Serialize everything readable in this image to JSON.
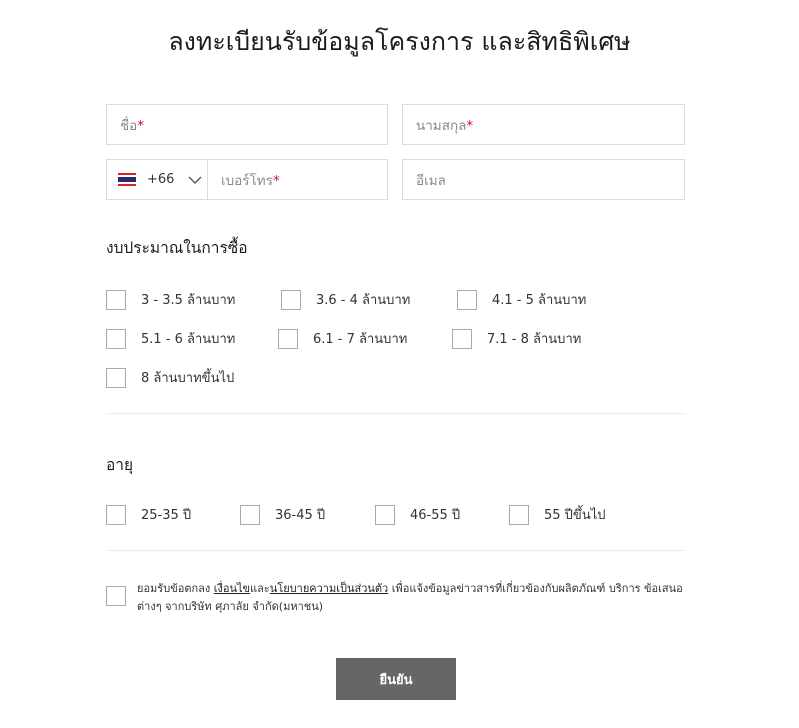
{
  "title": "ลงทะเบียนรับข้อมูลโครงการ และสิทธิพิเศษ",
  "form": {
    "first_name_placeholder": "ชื่อ",
    "last_name_placeholder": "นามสกุล",
    "phone_code": "+66",
    "phone_code_icon": "thailand-flag-icon",
    "phone_placeholder": "เบอร์โทร",
    "email_placeholder": "อีเมล",
    "required_marker": "*",
    "required_color": "#c8102e"
  },
  "budget": {
    "title": "งบประมาณในการซื้อ",
    "options": [
      "3 - 3.5 ล้านบาท",
      "3.6 - 4 ล้านบาท",
      "4.1 - 5 ล้านบาท",
      "5.1 - 6 ล้านบาท",
      "6.1 - 7 ล้านบาท",
      "7.1 - 8 ล้านบาท",
      "8 ล้านบาทขึ้นไป"
    ]
  },
  "age": {
    "title": "อายุ",
    "options": [
      "25-35 ปี",
      "36-45 ปี",
      "46-55 ปี",
      "55 ปีขึ้นไป"
    ]
  },
  "consent": {
    "prefix": "ยอมรับข้อตกลง ",
    "terms_link": "เงื่อนไข",
    "and": "และ",
    "privacy_link": "นโยบายความเป็นส่วนตัว",
    "suffix": " เพื่อแจ้งข้อมูลข่าวสารที่เกี่ยวข้องกับผลิตภัณฑ์ บริการ ข้อเสนอต่างๆ จากบริษัท ศุภาลัย จำกัด(มหาชน)"
  },
  "submit_label": "ยืนยัน",
  "colors": {
    "button": "#666666",
    "border": "#dcdcdc"
  }
}
